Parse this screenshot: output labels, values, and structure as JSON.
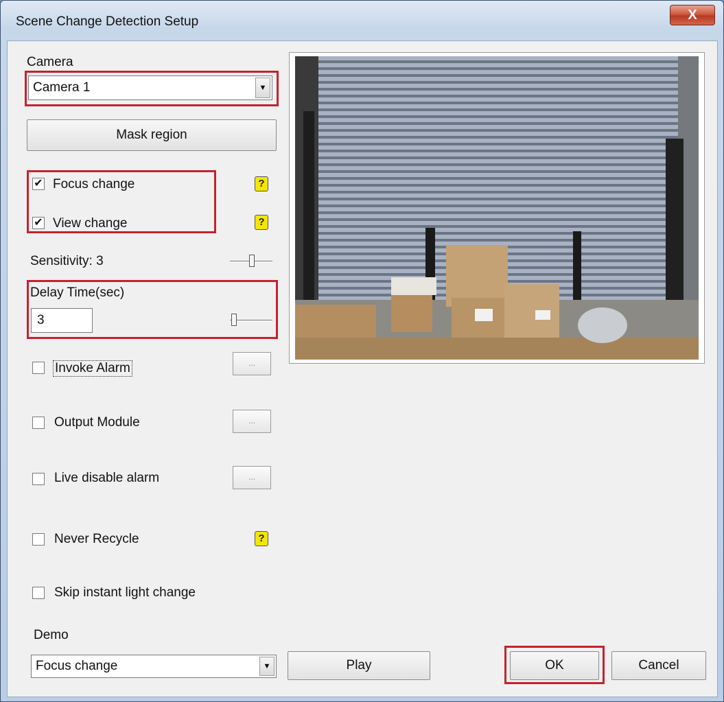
{
  "window": {
    "title": "Scene Change Detection Setup",
    "close_label": "X"
  },
  "camera": {
    "label": "Camera",
    "selected": "Camera 1"
  },
  "mask_button": "Mask region",
  "options": {
    "focus_change": {
      "label": "Focus change",
      "checked": true
    },
    "view_change": {
      "label": "View change",
      "checked": true
    },
    "invoke_alarm": {
      "label": "Invoke Alarm",
      "checked": false
    },
    "output_module": {
      "label": "Output Module",
      "checked": false
    },
    "live_disable_alarm": {
      "label": "Live disable alarm",
      "checked": false
    },
    "never_recycle": {
      "label": "Never Recycle",
      "checked": false
    },
    "skip_light_change": {
      "label": "Skip instant light change",
      "checked": false
    }
  },
  "help_glyph": "?",
  "dots_label": "...",
  "check_glyph": "✔",
  "sensitivity": {
    "label": "Sensitivity: 3",
    "value": 3
  },
  "delay": {
    "label": "Delay Time(sec)",
    "value": "3"
  },
  "demo": {
    "label": "Demo",
    "selected": "Focus change",
    "play_label": "Play"
  },
  "buttons": {
    "ok": "OK",
    "cancel": "Cancel"
  },
  "colors": {
    "highlight": "#c6212e",
    "help_icon": "#f4e600"
  }
}
